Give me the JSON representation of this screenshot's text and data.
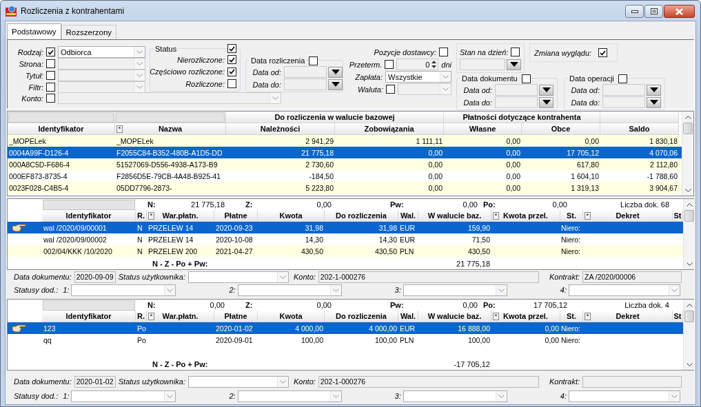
{
  "window": {
    "title": "Rozliczenia z kontrahentami"
  },
  "tabs": [
    {
      "label": "Podstawowy",
      "selected": true
    },
    {
      "label": "Rozszerzony",
      "selected": false
    }
  ],
  "filters": {
    "fields": [
      {
        "label": "Rodzaj:",
        "checked": true,
        "value": "Odbiorca"
      },
      {
        "label": "Strona:",
        "checked": false
      },
      {
        "label": "Tytuł:",
        "checked": false
      },
      {
        "label": "Filtr:",
        "checked": false
      }
    ],
    "account": {
      "label": "Konto:",
      "checked": false
    },
    "status": {
      "title": "Status",
      "checked": true,
      "options": [
        {
          "label": "Nierozliczone:",
          "checked": true
        },
        {
          "label": "Częściowo rozliczone:",
          "checked": true
        },
        {
          "label": "Rozliczone:",
          "checked": false
        }
      ]
    },
    "settlement_date": {
      "title": "Data rozliczenia",
      "checked": false,
      "from_label": "Data od:",
      "to_label": "Data do:"
    },
    "supplier_items": {
      "label": "Pozycje dostawcy:",
      "checked": false
    },
    "overdue": {
      "label": "Przeterm.",
      "checked": false,
      "value": "0",
      "unit": "dni"
    },
    "payment": {
      "label": "Zapłata:",
      "value": "Wszystkie"
    },
    "currency": {
      "label": "Waluta:",
      "checked": false
    },
    "as_of_date": {
      "label": "Stan na dzień:",
      "checked": false
    },
    "change_view": {
      "label": "Zmiana wyglądu:",
      "checked": true
    },
    "document_date": {
      "title": "Data dokumentu",
      "checked": false,
      "from_label": "Data od:",
      "to_label": "Data do:"
    },
    "operation_date": {
      "title": "Data operacji",
      "checked": false,
      "from_label": "Data od:",
      "to_label": "Data do:"
    }
  },
  "balances": {
    "header": [
      {
        "label": "Identyfikator",
        "search_box": true
      },
      {
        "label": "Nazwa",
        "search_box": true,
        "filter_button": "*"
      },
      {
        "group": "Do rozliczenia w walucie bazowej",
        "columns": [
          {
            "label": "Należności"
          },
          {
            "label": "Zobowiązania"
          }
        ]
      },
      {
        "group": "Płatności dotyczące kontrahenta",
        "columns": [
          {
            "label": "Własne"
          },
          {
            "label": "Obce"
          }
        ]
      },
      {
        "label": "Saldo",
        "search_box": false
      }
    ],
    "rows": [
      {
        "selected": false,
        "cells": [
          "_MOPELek",
          "_MOPELek",
          "2 941,29",
          "1 111,11",
          "0,00",
          "0,00",
          "1 830,18"
        ]
      },
      {
        "selected": true,
        "cells": [
          "0004A99F-D126-4",
          "F2055C84-B352-480B-A1D5-DD",
          "21 775,18",
          "0,00",
          "0,00",
          "17 705,12",
          "4 070,06"
        ]
      },
      {
        "selected": false,
        "cells": [
          "000A8C5D-F686-4",
          "51527069-D556-4938-A173-B9",
          "2 730,60",
          "0,00",
          "0,00",
          "617,80",
          "2 112,80"
        ]
      },
      {
        "selected": false,
        "cells": [
          "000EF873-8735-4",
          "F2856D5E-79CB-4A48-B925-41",
          "-184,50",
          "0,00",
          "0,00",
          "1 604,10",
          "-1 788,60"
        ]
      },
      {
        "selected": false,
        "cells": [
          "0023F028-C4B5-4",
          "05DD7796-2873-",
          "5 223,80",
          "0,00",
          "0,00",
          "1 319,13",
          "3 904,67"
        ]
      }
    ]
  },
  "documents": [
    {
      "summary": [
        {
          "label": "N:",
          "value": "21 775,18"
        },
        {
          "label": "Z:",
          "value": "0,00"
        },
        {
          "label": "Pw:",
          "value": "0,00"
        },
        {
          "label": "Po:",
          "value": "0,00"
        }
      ],
      "count": "Liczba dok. 68",
      "columns": [
        {
          "label": "Identyfikator"
        },
        {
          "label": "R."
        },
        {
          "label": "War.płatn.",
          "filter_button": "*"
        },
        {
          "label": "Płatne"
        },
        {
          "label": "Kwota"
        },
        {
          "label": "Do rozliczenia"
        },
        {
          "label": "Wal."
        },
        {
          "label": "W walucie baz."
        },
        {
          "label": "Kwota przel.",
          "filter_button": "*"
        },
        {
          "label": "St."
        },
        {
          "label": "Dekret",
          "filter_button": "*"
        },
        {
          "label": "St"
        }
      ],
      "rows": [
        {
          "selected": true,
          "cells": [
            "wal /2020/09/00001",
            "N",
            "PRZELEW 14",
            "2020-09-23",
            "31,98",
            "31,98",
            "EUR",
            "159,90",
            null,
            "Niero:"
          ]
        },
        {
          "selected": false,
          "cells": [
            "wal /2020/09/00002",
            "N",
            "PRZELEW 14",
            "2020-10-08",
            "14,30",
            "14,30",
            "EUR",
            "71,50",
            null,
            "Niero:"
          ]
        },
        {
          "selected": false,
          "cells": [
            "002/04/KKK /10/2020",
            "N",
            "PRZELEW 200",
            "2021-04-27",
            "430,50",
            "430,50",
            "PLN",
            "430,50",
            null,
            "Niero:"
          ]
        }
      ],
      "total_label": "N - Z - Po + Pw:",
      "total": "21 775,18",
      "details": {
        "document_date": {
          "label": "Data dokumentu:",
          "value": "2020-09-09"
        },
        "user_status": {
          "label": "Status użytkownika:"
        },
        "account": {
          "label": "Konto:",
          "value": "202-1-000276"
        },
        "contract": {
          "label": "Kontrakt:",
          "value": "ZA /2020/00006"
        },
        "extra_statuses": {
          "label": "Statusy dod.:",
          "slots": [
            {
              "label": "1:"
            },
            {
              "label": "2:"
            },
            {
              "label": "3:"
            },
            {
              "label": "4:"
            }
          ]
        }
      }
    },
    {
      "summary": [
        {
          "label": "N:",
          "value": "0,00"
        },
        {
          "label": "Z:",
          "value": "0,00"
        },
        {
          "label": "Pw:",
          "value": "0,00"
        },
        {
          "label": "Po:",
          "value": "17 705,12"
        }
      ],
      "count": "Liczba dok. 4",
      "columns": [
        {
          "label": "Identyfikator"
        },
        {
          "label": "R."
        },
        {
          "label": "War.płatn.",
          "filter_button": "*"
        },
        {
          "label": "Płatne"
        },
        {
          "label": "Kwota"
        },
        {
          "label": "Do rozliczenia"
        },
        {
          "label": "Wal."
        },
        {
          "label": "W walucie baz."
        },
        {
          "label": "Kwota przel.",
          "filter_button": "*"
        },
        {
          "label": "St."
        },
        {
          "label": "Dekret",
          "filter_button": "*"
        },
        {
          "label": "St"
        }
      ],
      "rows": [
        {
          "selected": true,
          "cells": [
            "123",
            "Po",
            null,
            "2020-01-02",
            "4 000,00",
            "4 000,00",
            "EUR",
            "16 888,00",
            "0,00",
            "Niero:"
          ]
        },
        {
          "selected": false,
          "cells": [
            "qq",
            "Po",
            null,
            "2020-09-01",
            "100,00",
            "100,00",
            "PLN",
            "100,00",
            "0,00",
            "Niero:"
          ]
        }
      ],
      "total_label": "N - Z - Po + Pw:",
      "total": "-17 705,12",
      "details": {
        "document_date": {
          "label": "Data dokumentu:",
          "value": "2020-01-02"
        },
        "user_status": {
          "label": "Status użytkownika:"
        },
        "account": {
          "label": "Konto:",
          "value": "202-1-000276"
        },
        "contract": {
          "label": "Kontrakt:"
        },
        "extra_statuses": {
          "label": "Statusy dod.:",
          "slots": [
            {
              "label": "1:"
            },
            {
              "label": "2:"
            },
            {
              "label": "3:"
            },
            {
              "label": "4:"
            }
          ]
        }
      }
    }
  ]
}
